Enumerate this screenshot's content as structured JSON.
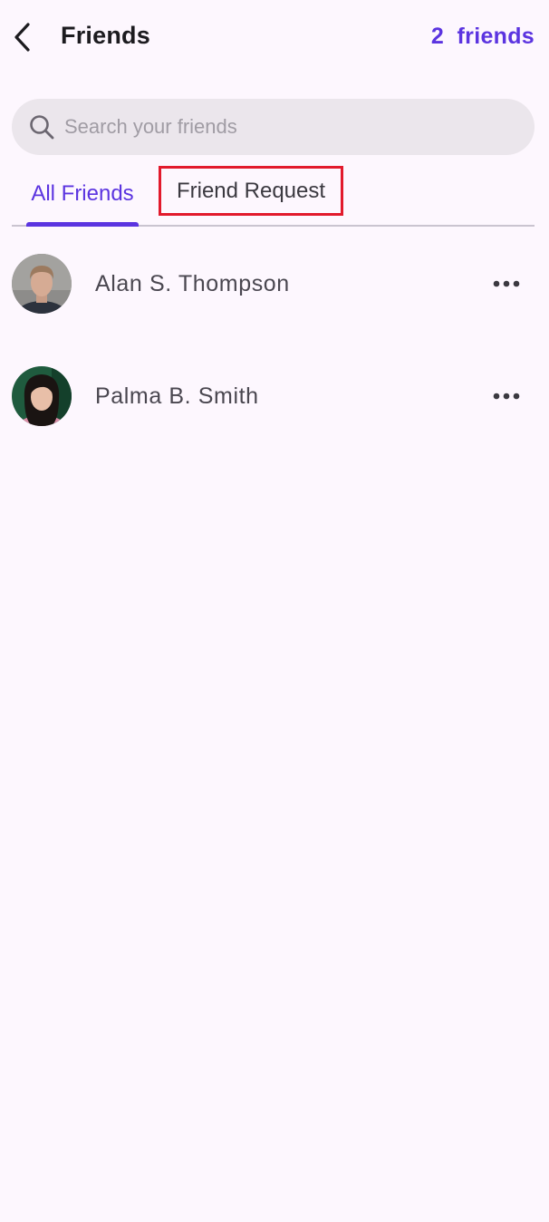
{
  "header": {
    "back_icon": "chevron-left-icon",
    "title": "Friends",
    "count_label": "2  friends"
  },
  "search": {
    "icon": "search-icon",
    "placeholder": "Search your friends",
    "value": ""
  },
  "tabs": [
    {
      "label": "All Friends",
      "active": true
    },
    {
      "label": "Friend Request",
      "active": false,
      "highlighted": true
    }
  ],
  "friends": [
    {
      "name": "Alan S. Thompson",
      "menu_icon": "more-horizontal-icon"
    },
    {
      "name": "Palma B. Smith",
      "menu_icon": "more-horizontal-icon"
    }
  ],
  "colors": {
    "accent": "#5b34e0",
    "background": "#fdf7fe",
    "search_bg": "#ebe6ec",
    "highlight_border": "#e21a2c"
  }
}
